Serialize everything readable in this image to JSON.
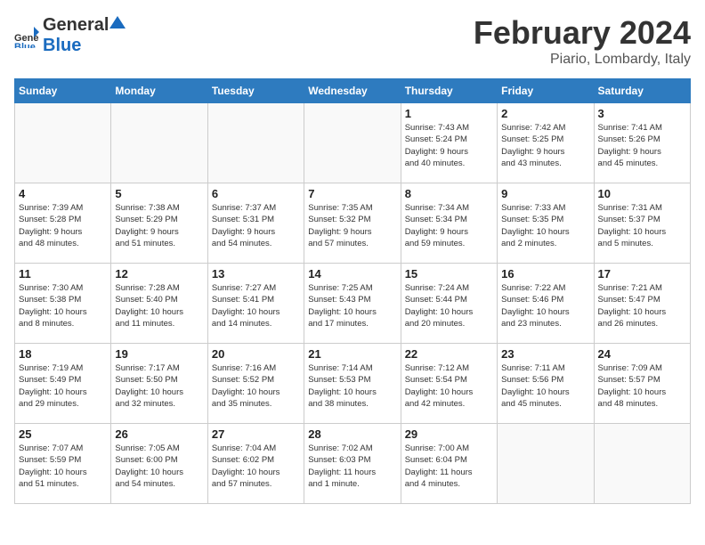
{
  "header": {
    "logo_general": "General",
    "logo_blue": "Blue",
    "title": "February 2024",
    "subtitle": "Piario, Lombardy, Italy"
  },
  "days": [
    "Sunday",
    "Monday",
    "Tuesday",
    "Wednesday",
    "Thursday",
    "Friday",
    "Saturday"
  ],
  "weeks": [
    [
      {
        "date": "",
        "info": ""
      },
      {
        "date": "",
        "info": ""
      },
      {
        "date": "",
        "info": ""
      },
      {
        "date": "",
        "info": ""
      },
      {
        "date": "1",
        "info": "Sunrise: 7:43 AM\nSunset: 5:24 PM\nDaylight: 9 hours\nand 40 minutes."
      },
      {
        "date": "2",
        "info": "Sunrise: 7:42 AM\nSunset: 5:25 PM\nDaylight: 9 hours\nand 43 minutes."
      },
      {
        "date": "3",
        "info": "Sunrise: 7:41 AM\nSunset: 5:26 PM\nDaylight: 9 hours\nand 45 minutes."
      }
    ],
    [
      {
        "date": "4",
        "info": "Sunrise: 7:39 AM\nSunset: 5:28 PM\nDaylight: 9 hours\nand 48 minutes."
      },
      {
        "date": "5",
        "info": "Sunrise: 7:38 AM\nSunset: 5:29 PM\nDaylight: 9 hours\nand 51 minutes."
      },
      {
        "date": "6",
        "info": "Sunrise: 7:37 AM\nSunset: 5:31 PM\nDaylight: 9 hours\nand 54 minutes."
      },
      {
        "date": "7",
        "info": "Sunrise: 7:35 AM\nSunset: 5:32 PM\nDaylight: 9 hours\nand 57 minutes."
      },
      {
        "date": "8",
        "info": "Sunrise: 7:34 AM\nSunset: 5:34 PM\nDaylight: 9 hours\nand 59 minutes."
      },
      {
        "date": "9",
        "info": "Sunrise: 7:33 AM\nSunset: 5:35 PM\nDaylight: 10 hours\nand 2 minutes."
      },
      {
        "date": "10",
        "info": "Sunrise: 7:31 AM\nSunset: 5:37 PM\nDaylight: 10 hours\nand 5 minutes."
      }
    ],
    [
      {
        "date": "11",
        "info": "Sunrise: 7:30 AM\nSunset: 5:38 PM\nDaylight: 10 hours\nand 8 minutes."
      },
      {
        "date": "12",
        "info": "Sunrise: 7:28 AM\nSunset: 5:40 PM\nDaylight: 10 hours\nand 11 minutes."
      },
      {
        "date": "13",
        "info": "Sunrise: 7:27 AM\nSunset: 5:41 PM\nDaylight: 10 hours\nand 14 minutes."
      },
      {
        "date": "14",
        "info": "Sunrise: 7:25 AM\nSunset: 5:43 PM\nDaylight: 10 hours\nand 17 minutes."
      },
      {
        "date": "15",
        "info": "Sunrise: 7:24 AM\nSunset: 5:44 PM\nDaylight: 10 hours\nand 20 minutes."
      },
      {
        "date": "16",
        "info": "Sunrise: 7:22 AM\nSunset: 5:46 PM\nDaylight: 10 hours\nand 23 minutes."
      },
      {
        "date": "17",
        "info": "Sunrise: 7:21 AM\nSunset: 5:47 PM\nDaylight: 10 hours\nand 26 minutes."
      }
    ],
    [
      {
        "date": "18",
        "info": "Sunrise: 7:19 AM\nSunset: 5:49 PM\nDaylight: 10 hours\nand 29 minutes."
      },
      {
        "date": "19",
        "info": "Sunrise: 7:17 AM\nSunset: 5:50 PM\nDaylight: 10 hours\nand 32 minutes."
      },
      {
        "date": "20",
        "info": "Sunrise: 7:16 AM\nSunset: 5:52 PM\nDaylight: 10 hours\nand 35 minutes."
      },
      {
        "date": "21",
        "info": "Sunrise: 7:14 AM\nSunset: 5:53 PM\nDaylight: 10 hours\nand 38 minutes."
      },
      {
        "date": "22",
        "info": "Sunrise: 7:12 AM\nSunset: 5:54 PM\nDaylight: 10 hours\nand 42 minutes."
      },
      {
        "date": "23",
        "info": "Sunrise: 7:11 AM\nSunset: 5:56 PM\nDaylight: 10 hours\nand 45 minutes."
      },
      {
        "date": "24",
        "info": "Sunrise: 7:09 AM\nSunset: 5:57 PM\nDaylight: 10 hours\nand 48 minutes."
      }
    ],
    [
      {
        "date": "25",
        "info": "Sunrise: 7:07 AM\nSunset: 5:59 PM\nDaylight: 10 hours\nand 51 minutes."
      },
      {
        "date": "26",
        "info": "Sunrise: 7:05 AM\nSunset: 6:00 PM\nDaylight: 10 hours\nand 54 minutes."
      },
      {
        "date": "27",
        "info": "Sunrise: 7:04 AM\nSunset: 6:02 PM\nDaylight: 10 hours\nand 57 minutes."
      },
      {
        "date": "28",
        "info": "Sunrise: 7:02 AM\nSunset: 6:03 PM\nDaylight: 11 hours\nand 1 minute."
      },
      {
        "date": "29",
        "info": "Sunrise: 7:00 AM\nSunset: 6:04 PM\nDaylight: 11 hours\nand 4 minutes."
      },
      {
        "date": "",
        "info": ""
      },
      {
        "date": "",
        "info": ""
      }
    ]
  ]
}
